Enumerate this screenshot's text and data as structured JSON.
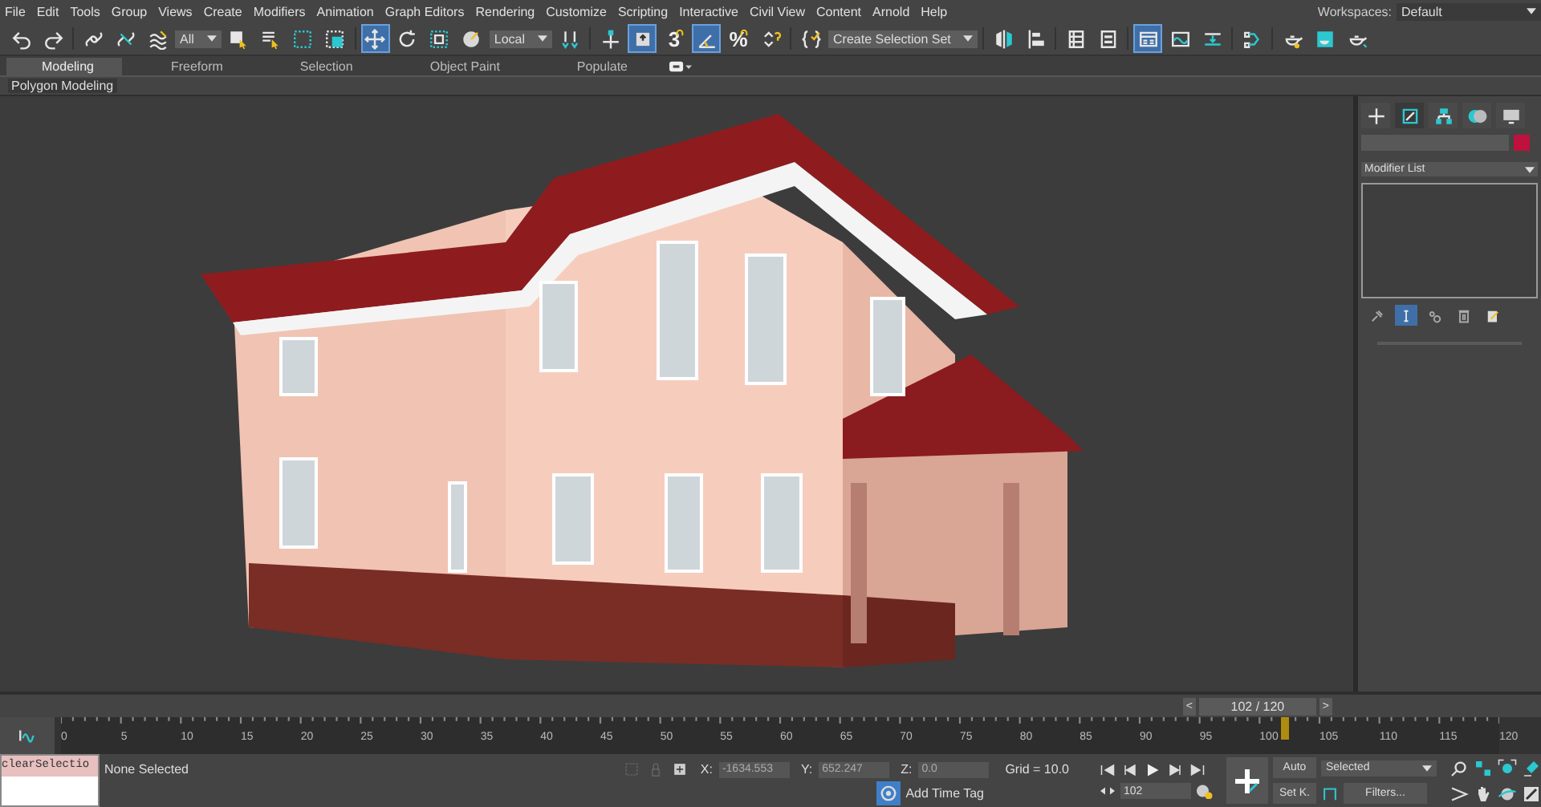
{
  "menu": [
    "File",
    "Edit",
    "Tools",
    "Group",
    "Views",
    "Create",
    "Modifiers",
    "Animation",
    "Graph Editors",
    "Rendering",
    "Customize",
    "Scripting",
    "Interactive",
    "Civil View",
    "Content",
    "Arnold",
    "Help"
  ],
  "workspace": {
    "label": "Workspaces:",
    "value": "Default"
  },
  "toolbar": [
    {
      "kind": "undo",
      "selected": false
    },
    {
      "kind": "redo",
      "selected": false
    },
    {
      "kind": "sep"
    },
    {
      "kind": "link",
      "selected": false
    },
    {
      "kind": "unlink",
      "selected": false
    },
    {
      "kind": "bind",
      "selected": false
    },
    {
      "kind": "dropdown",
      "value": "All"
    },
    {
      "kind": "select",
      "selected": false
    },
    {
      "kind": "select_name",
      "selected": false
    },
    {
      "kind": "region",
      "selected": false
    },
    {
      "kind": "crossing",
      "selected": false
    },
    {
      "kind": "sep"
    },
    {
      "kind": "move",
      "selected": true
    },
    {
      "kind": "rotate",
      "selected": false
    },
    {
      "kind": "scale",
      "selected": false
    },
    {
      "kind": "placement",
      "selected": false
    },
    {
      "kind": "dropdown",
      "value": "Local"
    },
    {
      "kind": "pivot",
      "selected": false
    },
    {
      "kind": "sep"
    },
    {
      "kind": "manip",
      "selected": false
    },
    {
      "kind": "shortcut",
      "selected": true
    },
    {
      "kind": "glyph",
      "glyph": "3",
      "selected": false
    },
    {
      "kind": "angle",
      "selected": true
    },
    {
      "kind": "glyph",
      "glyph": "%",
      "selected": false
    },
    {
      "kind": "spinner",
      "selected": false
    },
    {
      "kind": "sep"
    },
    {
      "kind": "named_sets",
      "selected": false
    },
    {
      "kind": "dropdown",
      "value": "Create Selection Set"
    },
    {
      "kind": "sep"
    },
    {
      "kind": "mirror",
      "selected": false
    },
    {
      "kind": "align",
      "selected": false
    },
    {
      "kind": "sep"
    },
    {
      "kind": "explorer",
      "selected": false
    },
    {
      "kind": "layer",
      "selected": false
    },
    {
      "kind": "sep"
    },
    {
      "kind": "ribbon",
      "selected": true
    },
    {
      "kind": "curve",
      "selected": false
    },
    {
      "kind": "dope",
      "selected": false
    },
    {
      "kind": "sep"
    },
    {
      "kind": "schematic",
      "selected": false
    },
    {
      "kind": "sep"
    },
    {
      "kind": "material",
      "selected": false
    },
    {
      "kind": "render_setup",
      "selected": false
    },
    {
      "kind": "render",
      "selected": false
    }
  ],
  "ribbon": {
    "tabs": [
      {
        "label": "Modeling",
        "selected": true
      },
      {
        "label": "Freeform",
        "selected": false
      },
      {
        "label": "Selection",
        "selected": false
      },
      {
        "label": "Object Paint",
        "selected": false
      },
      {
        "label": "Populate",
        "selected": false
      }
    ],
    "panel": "Polygon Modeling"
  },
  "command_panel": {
    "tabs": [
      {
        "kind": "create",
        "selected": false
      },
      {
        "kind": "modify",
        "selected": true
      },
      {
        "kind": "hierarchy",
        "selected": false
      },
      {
        "kind": "motion",
        "selected": false
      },
      {
        "kind": "display",
        "selected": false
      }
    ],
    "modifier_list": "Modifier List",
    "stack_tools": [
      {
        "kind": "pin",
        "selected": false
      },
      {
        "kind": "end_result",
        "selected": true
      },
      {
        "kind": "unique",
        "selected": false
      },
      {
        "kind": "remove",
        "selected": false
      },
      {
        "kind": "configure",
        "selected": false
      }
    ]
  },
  "timeline": {
    "prev": "<",
    "frame": "102 / 120",
    "next": ">",
    "level": 0.85,
    "labels": [
      "0",
      "5",
      "10",
      "15",
      "20",
      "25",
      "30",
      "35",
      "40",
      "45",
      "50",
      "55",
      "60",
      "65",
      "70",
      "75",
      "80",
      "85",
      "90",
      "95",
      "100",
      "105",
      "110",
      "115",
      "120"
    ]
  },
  "status": {
    "listener": "clearSelectio",
    "selection": "None Selected",
    "coords": [
      {
        "label": "X:",
        "value": "-1634.553"
      },
      {
        "label": "Y:",
        "value": "652.247"
      },
      {
        "label": "Z:",
        "value": "0.0"
      }
    ],
    "grid": "Grid = 10.0",
    "time_tag": "Add Time Tag",
    "frame": "102",
    "auto": "Auto",
    "set_key": "Set K.",
    "key_filter": "Selected",
    "filters": "Filters..."
  }
}
